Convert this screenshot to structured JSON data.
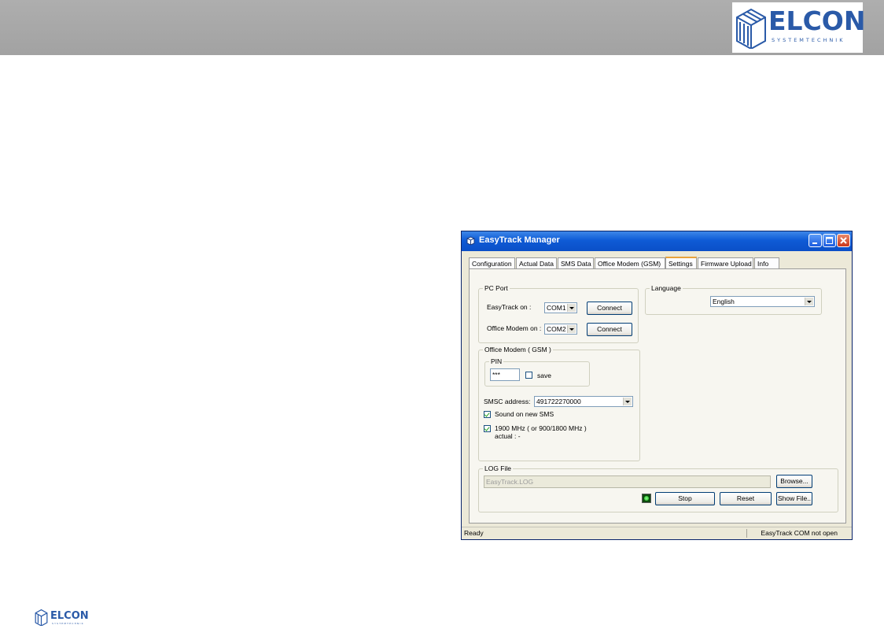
{
  "brand": {
    "name": "ELCON",
    "sub": "SYSTEMTECHNIK",
    "color": "#2a5aa8"
  },
  "window": {
    "title": "EasyTrack Manager",
    "controls": {
      "minimize": "minimize-icon",
      "maximize": "maximize-icon",
      "close": "close-icon"
    }
  },
  "tabs": [
    {
      "label": "Configuration"
    },
    {
      "label": "Actual Data"
    },
    {
      "label": "SMS Data"
    },
    {
      "label": "Office Modem (GSM)"
    },
    {
      "label": "Settings",
      "active": true
    },
    {
      "label": "Firmware Upload"
    },
    {
      "label": "Info"
    }
  ],
  "pc_port": {
    "legend": "PC Port",
    "easytrack_label": "EasyTrack on :",
    "easytrack_value": "COM1",
    "modem_label": "Office Modem on :",
    "modem_value": "COM2",
    "connect_label": "Connect"
  },
  "language": {
    "legend": "Language",
    "value": "English"
  },
  "office_modem": {
    "legend": "Office Modem ( GSM )",
    "pin_legend": "PIN",
    "pin_value": "***",
    "save_label": "save",
    "save_checked": false,
    "smsc_label": "SMSC address:",
    "smsc_value": "491722270000",
    "sound_label": "Sound on new SMS",
    "sound_checked": true,
    "band_label": "1900 MHz ( or 900/1800 MHz )",
    "band_checked": true,
    "actual_label": "actual :  -"
  },
  "log_file": {
    "legend": "LOG File",
    "path": "EasyTrack.LOG",
    "browse_label": "Browse...",
    "stop_label": "Stop",
    "reset_label": "Reset",
    "show_label": "Show File..",
    "led_color": "#17b317"
  },
  "status": {
    "left": "Ready",
    "right": "EasyTrack COM not open"
  }
}
